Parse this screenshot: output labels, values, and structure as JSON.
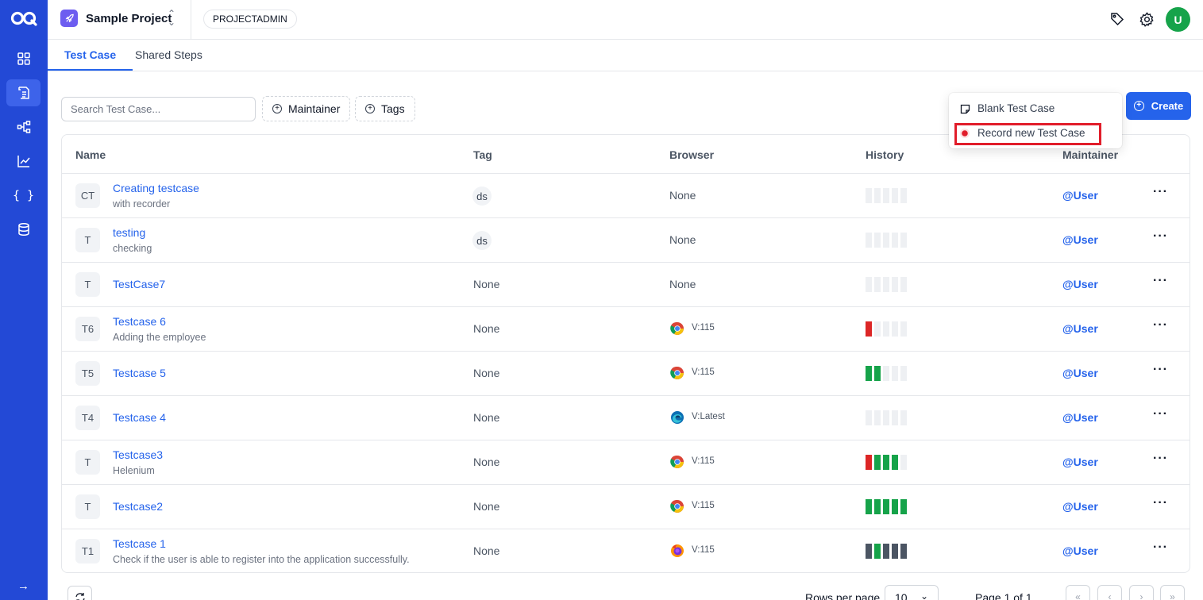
{
  "app": {
    "logo": "OQ",
    "project_name": "Sample Project",
    "role": "PROJECTADMIN",
    "avatar_initial": "U"
  },
  "sidebar": {
    "items": [
      {
        "icon": "dashboard-grid-icon",
        "active": false
      },
      {
        "icon": "test-case-list-icon",
        "active": true
      },
      {
        "icon": "workflow-icon",
        "active": false
      },
      {
        "icon": "reports-chart-icon",
        "active": false
      },
      {
        "icon": "curly-braces-icon",
        "label": "{ }",
        "active": false
      },
      {
        "icon": "database-icon",
        "active": false
      }
    ],
    "expand_icon": "→"
  },
  "tabs": [
    {
      "label": "Test Case",
      "active": true
    },
    {
      "label": "Shared Steps",
      "active": false
    }
  ],
  "filters": {
    "search_placeholder": "Search Test Case...",
    "maintainer_label": "Maintainer",
    "tags_label": "Tags"
  },
  "create_button": "Create",
  "create_menu": {
    "items": [
      {
        "label": "Blank Test Case",
        "icon": "note-icon"
      },
      {
        "label": "Record new Test Case",
        "icon": "record-icon"
      }
    ]
  },
  "table": {
    "headers": [
      "Name",
      "Tag",
      "Browser",
      "History",
      "Maintainer"
    ],
    "rows": [
      {
        "abbr": "CT",
        "name": "Creating testcase",
        "desc": "with recorder",
        "tag": "ds",
        "browser": null,
        "version": "",
        "history": [
          "empty",
          "empty",
          "empty",
          "empty",
          "empty"
        ],
        "maintainer": "@User"
      },
      {
        "abbr": "T",
        "name": "testing",
        "desc": "checking",
        "tag": "ds",
        "browser": null,
        "version": "",
        "history": [
          "empty",
          "empty",
          "empty",
          "empty",
          "empty"
        ],
        "maintainer": "@User"
      },
      {
        "abbr": "T",
        "name": "TestCase7",
        "desc": "",
        "tag": null,
        "browser": null,
        "version": "",
        "history": [
          "empty",
          "empty",
          "empty",
          "empty",
          "empty"
        ],
        "maintainer": "@User"
      },
      {
        "abbr": "T6",
        "name": "Testcase 6",
        "desc": "Adding the employee",
        "tag": null,
        "browser": "chrome",
        "version": "V:115",
        "history": [
          "fail",
          "empty",
          "empty",
          "empty",
          "empty"
        ],
        "maintainer": "@User"
      },
      {
        "abbr": "T5",
        "name": "Testcase 5",
        "desc": "",
        "tag": null,
        "browser": "chrome",
        "version": "V:115",
        "history": [
          "pass",
          "pass",
          "empty",
          "empty",
          "empty"
        ],
        "maintainer": "@User"
      },
      {
        "abbr": "T4",
        "name": "Testcase 4",
        "desc": "",
        "tag": null,
        "browser": "edge",
        "version": "V:Latest",
        "history": [
          "empty",
          "empty",
          "empty",
          "empty",
          "empty"
        ],
        "maintainer": "@User"
      },
      {
        "abbr": "T",
        "name": "Testcase3",
        "desc": "Helenium",
        "tag": null,
        "browser": "chrome",
        "version": "V:115",
        "history": [
          "fail",
          "pass",
          "pass",
          "pass",
          "empty"
        ],
        "maintainer": "@User"
      },
      {
        "abbr": "T",
        "name": "Testcase2",
        "desc": "",
        "tag": null,
        "browser": "chrome",
        "version": "V:115",
        "history": [
          "pass",
          "pass",
          "pass",
          "pass",
          "pass"
        ],
        "maintainer": "@User"
      },
      {
        "abbr": "T1",
        "name": "Testcase 1",
        "desc": "Check if the user is able to register into the application successfully.",
        "tag": null,
        "browser": "firefox",
        "version": "V:115",
        "history": [
          "dark",
          "pass",
          "dark",
          "dark",
          "dark"
        ],
        "maintainer": "@User"
      }
    ],
    "none_text": "None",
    "more_text": "···"
  },
  "pagination": {
    "rows_label": "Rows per page",
    "rows_value": "10",
    "page_label": "Page 1 of  1"
  },
  "colors": {
    "sidebar": "#2349d6",
    "accent": "#2563eb",
    "pass": "#16a34a",
    "fail": "#dc2626",
    "highlight": "#e11d2a"
  }
}
